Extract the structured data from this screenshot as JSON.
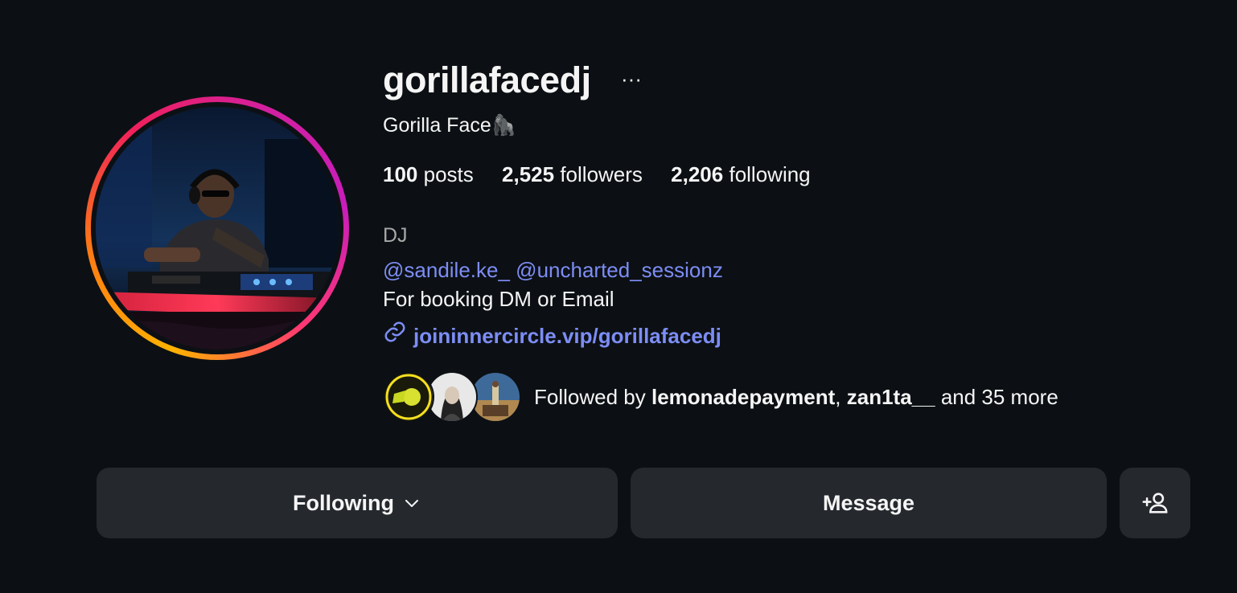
{
  "profile": {
    "username": "gorillafacedj",
    "more_label": "···",
    "full_name": "Gorilla Face🦍",
    "stats": {
      "posts_count": "100",
      "posts_label": "posts",
      "followers_count": "2,525",
      "followers_label": "followers",
      "following_count": "2,206",
      "following_label": "following"
    },
    "category": "DJ",
    "bio": {
      "mention_1": "@sandile.ke_",
      "mention_2": "@uncharted_sessionz",
      "booking_line": "For booking DM or Email"
    },
    "link": "joininnercircle.vip/gorillafacedj",
    "followed_by": {
      "prefix": "Followed by",
      "user_1": "lemonadepayment",
      "separator": ",",
      "user_2": "zan1ta__",
      "suffix": "and 35 more"
    }
  },
  "actions": {
    "following_label": "Following",
    "message_label": "Message"
  },
  "icons": {
    "more": "more-icon",
    "link": "link-icon",
    "chevron": "chevron-down-icon",
    "add_user": "add-user-icon"
  },
  "colors": {
    "background": "#0c1014",
    "link": "#7d8df5",
    "button": "#25292e",
    "muted": "#a8a8a8"
  }
}
